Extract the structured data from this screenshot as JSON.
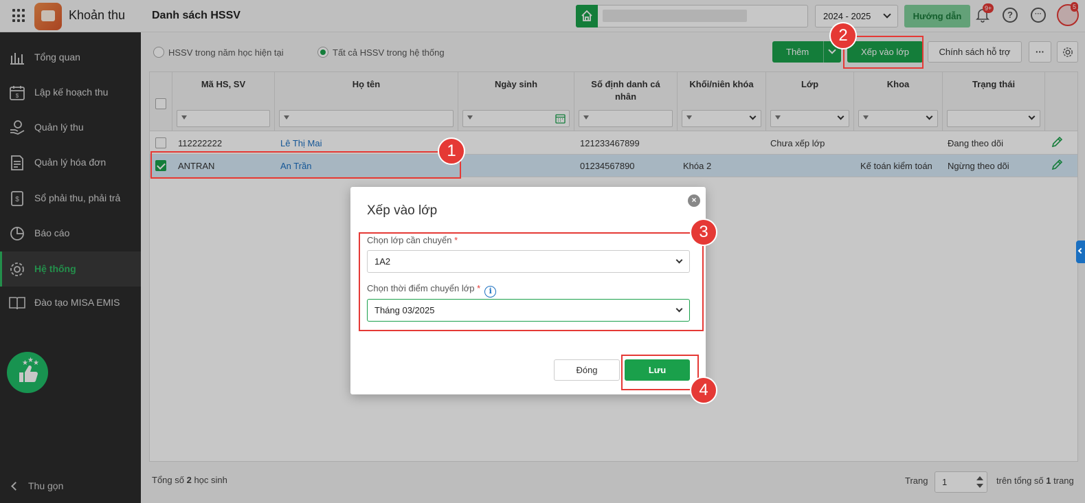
{
  "topbar": {
    "app_name": "Khoản thu",
    "page_title": "Danh sách HSSV",
    "school_year": "2024 - 2025",
    "guide_label": "Hướng dẫn",
    "notif_count": "9+",
    "avatar_badge": "5",
    "help_icon": "?",
    "more_icon": "···"
  },
  "sidebar": {
    "items": [
      {
        "label": "Tổng quan",
        "icon": "chart-bars-icon"
      },
      {
        "label": "Lập kế hoạch thu",
        "icon": "calendar-money-icon"
      },
      {
        "label": "Quản lý thu",
        "icon": "hand-coin-icon"
      },
      {
        "label": "Quản lý hóa đơn",
        "icon": "invoice-icon"
      },
      {
        "label": "Sổ phải thu, phải trả",
        "icon": "ledger-icon"
      },
      {
        "label": "Báo cáo",
        "icon": "pie-chart-icon"
      },
      {
        "label": "Hệ thống",
        "icon": "gear-icon",
        "active": true
      },
      {
        "label": "Đào tạo MISA EMIS",
        "icon": "book-icon"
      }
    ],
    "collapse_label": "Thu gọn"
  },
  "toolbar": {
    "radio_current": "HSSV trong năm học hiện tại",
    "radio_all": "Tất cả HSSV trong hệ thống",
    "add_label": "Thêm",
    "assign_label": "Xếp vào lớp",
    "policy_label": "Chính sách hỗ trợ"
  },
  "table": {
    "headers": {
      "code": "Mã HS, SV",
      "name": "Họ tên",
      "dob": "Ngày sinh",
      "pid": "Số định danh cá nhân",
      "grade": "Khối/niên khóa",
      "class": "Lớp",
      "dept": "Khoa",
      "status": "Trạng thái"
    },
    "rows": [
      {
        "code": "112222222",
        "name": "Lê Thị Mai",
        "dob": "",
        "pid": "121233467899",
        "grade": "",
        "class": "Chưa xếp lớp",
        "dept": "",
        "status": "Đang theo dõi",
        "checked": false
      },
      {
        "code": "ANTRAN",
        "name": "An Trần",
        "dob": "",
        "pid": "01234567890",
        "grade": "Khóa 2",
        "class": "",
        "dept": "Kế toán kiểm toán",
        "status": "Ngừng theo dõi",
        "checked": true
      }
    ]
  },
  "footer": {
    "total_prefix": "Tổng số ",
    "total_count": "2",
    "total_suffix": " học sinh",
    "page_label": "Trang",
    "page_value": "1",
    "pages_prefix": "trên tổng số ",
    "pages_total": "1",
    "pages_suffix": " trang"
  },
  "dialog": {
    "title": "Xếp vào lớp",
    "class_label": "Chọn lớp cần chuyển",
    "class_value": "1A2",
    "time_label": "Chọn thời điểm chuyển lớp",
    "time_value": "Tháng 03/2025",
    "close_label": "Đóng",
    "save_label": "Lưu",
    "required_mark": "*",
    "info_glyph": "i",
    "close_glyph": "×"
  },
  "annotations": [
    "1",
    "2",
    "3",
    "4"
  ],
  "colors": {
    "accent": "#1aa04b",
    "sidebar_bg": "#2c2c2c",
    "annotation": "#e53935",
    "link": "#1a6fc0",
    "selected_row": "#d6e9f8"
  }
}
